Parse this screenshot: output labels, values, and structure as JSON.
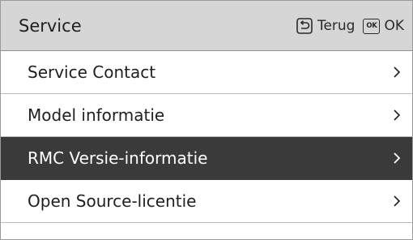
{
  "header": {
    "title": "Service",
    "back_label": "Terug",
    "ok_icon_text": "OK",
    "ok_label": "OK"
  },
  "menu": {
    "items": [
      {
        "label": "Service Contact",
        "selected": false
      },
      {
        "label": "Model informatie",
        "selected": false
      },
      {
        "label": "RMC Versie-informatie",
        "selected": true
      },
      {
        "label": "Open Source-licentie",
        "selected": false
      }
    ]
  },
  "icons": {
    "back": "return-arrow-icon",
    "ok": "ok-key-icon",
    "chevron": "chevron-right-icon"
  },
  "colors": {
    "header_bg": "#d6d6d6",
    "selected_bg": "#3a3a3a",
    "text": "#1f1f1f"
  }
}
